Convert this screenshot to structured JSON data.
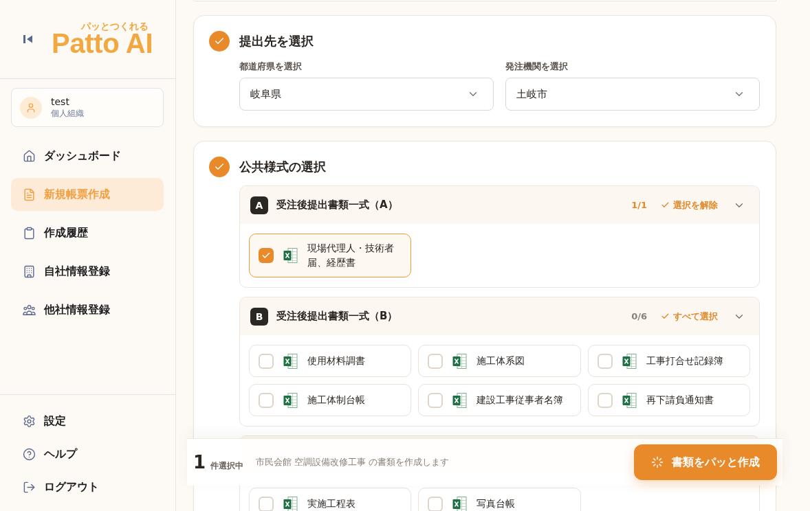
{
  "sidebar": {
    "logo": {
      "tagline": "パッとつくれる",
      "name": "Patto AI"
    },
    "user": {
      "name": "test",
      "organization": "個人組織"
    },
    "nav": [
      {
        "label": "ダッシュボード",
        "selected": false
      },
      {
        "label": "新規帳票作成",
        "selected": true
      },
      {
        "label": "作成履歴",
        "selected": false
      },
      {
        "label": "自社情報登録",
        "selected": false
      },
      {
        "label": "他社情報登録",
        "selected": false
      }
    ],
    "footer_nav": [
      {
        "label": "設定",
        "selected": false
      },
      {
        "label": "ヘルプ",
        "selected": false
      },
      {
        "label": "ログアウト",
        "selected": false
      }
    ]
  },
  "sections": [
    {
      "kind": "destination",
      "title": "提出先を選択",
      "done": true,
      "fields": [
        {
          "label": "都道府県を選択",
          "value": "岐阜県"
        },
        {
          "label": "発注機関を選択",
          "value": "土岐市"
        }
      ]
    },
    {
      "kind": "forms",
      "title": "公共様式の選択",
      "done": true,
      "groups": [
        {
          "badge": "A",
          "title": "受注後提出書類一式（A）",
          "count": "1/1",
          "all_selected": true,
          "action": "選択を解除",
          "expanded": true,
          "items": [
            {
              "label": "現場代理人・技術者届、経歴書",
              "checked": true
            }
          ]
        },
        {
          "badge": "B",
          "title": "受注後提出書類一式（B）",
          "count": "0/6",
          "all_selected": false,
          "action": "すべて選択",
          "expanded": true,
          "items": [
            {
              "label": "使用材料調書",
              "checked": false
            },
            {
              "label": "施工体系図",
              "checked": false
            },
            {
              "label": "工事打合せ記録簿",
              "checked": false
            },
            {
              "label": "施工体制台帳",
              "checked": false
            },
            {
              "label": "建設工事従事者名簿",
              "checked": false
            },
            {
              "label": "再下請負通知書",
              "checked": false
            }
          ]
        },
        {
          "items": [
            {
              "label": "実施工程表",
              "checked": false
            },
            {
              "label": "写真台帳",
              "checked": false
            }
          ]
        }
      ]
    }
  ],
  "action_bar": {
    "count": "1",
    "count_label": "件選択中",
    "summary": "市民会館 空調設備改修工事 の書類を作成します",
    "button": "書類をパッと作成"
  }
}
